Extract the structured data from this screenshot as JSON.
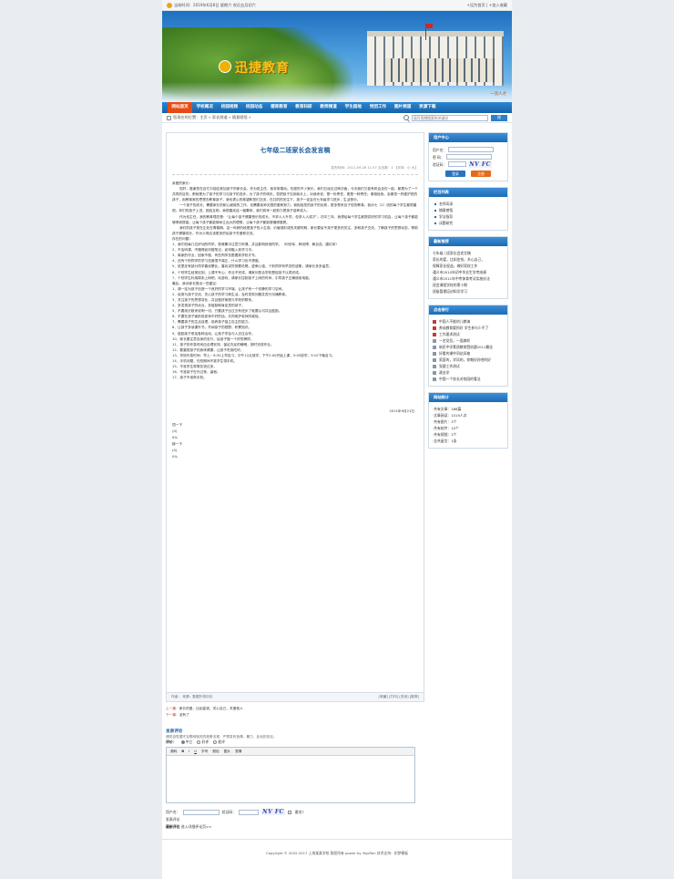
{
  "topbar": {
    "datetime": "当前时间：2019年6月8日 星期六 农历五月初六",
    "links": "+设为首页 | +加入收藏"
  },
  "banner": {
    "logo": "迅捷教育",
    "caption": "一流人才"
  },
  "nav": {
    "items": [
      "网站首页",
      "学校概况",
      "校园视频",
      "校园动态",
      "德育教育",
      "教育科研",
      "教师频道",
      "学生园地",
      "党团工作",
      "图片频道",
      "资源下载"
    ]
  },
  "subbar": {
    "breadcrumb": "您现在的位置：主页 » 家长频道 » 随意感悟 »",
    "search_placeholder": "填写您想搜索的关键词",
    "search_button": "搜"
  },
  "article": {
    "title": "七年级二班家长会发言稿",
    "meta": "发布时间：2011-09-26 11:37   点击数：1   【字体：小 大】",
    "paragraphs": [
      "亲爱的家长：",
      "您好，感谢您在百忙中抽空参加孩子的家长会，作为班主任，我非常感动。在座的不少家长，我们已经见过两次面，今天我们又能有机会坐在一起，都是为了一个共同的目的，那就是为了孩子的学习与孩子的进步。为了孩子的明天，您把孩子交到我手上，对我来说，是一份责任，更是一种责任；请相信我，会像您一样爱护您的孩子，用教育家的思想去教育孩子，我也衷心的希望和您们交流，在共同的关注下，孩子一定会在七年级学习进步，生活快乐。",
      "一个孩子的成长，需要家长的耐心细致的工作，也需要老师无限的爱和努力，我相信您的孩子的优秀，更多是来自于您的教育。我对七（2）班的每个学生都很重视，你们的孩子上进，团结互助，我很喜欢这一届集体，我们将来一起努力把孩子培养成人。",
      "作为班主任，我的教育理念是：“让每个孩子健康快乐的成长，不求人人升学，但求人人成才”。初中三年，我想给每个学生都提供好的学习机会，让每个孩子都能够得到提高，让每个孩子都能够树立远大的理想，让每个孩子都能够懂得感恩。",
      "我们的孩子现在正处在青春期，这一年龄阶段是孩子的人生观、价值观形成的关键时期，家长要给予孩子更多的关注，多和孩子交流，了解孩子的思想动态，帮助孩子健康成长，作为父母应该更多的给孩子关爱和交流。",
      "存在的问题：",
      "1、我们班每几位好动的同学，很难集中注意力听课，并且影响其他同学。（何世军、韩世博、黄百浩、唐红军）",
      "2、不会听课，不懂得如何做笔记，如何融入到学习中。",
      "3、离家的作业，回家不做，有些同学总是要到学校才写。",
      "4、还有个别同学的学习态度很不端正，什么学习也不想做。",
      "5、班里还有部分同学喜欢攀比，喜欢讲究穿着吃喝，虚荣心强，个别同学有早恋的迹象，请家长多多留意。",
      "6、个别学生经常迟到，上课不专心，作业不完成，请家长配合学校督促孩子认真完成。",
      "7、个别学生利用周末上网吧，玩游戏，请家长控制孩子上网的时间，引导孩子正确使用电脑。",
      "最后，我对家长提出一些建议：",
      "1、请一定为孩子创造一个良好的学习环境，让孩子有一个安静的学习空间。",
      "2、经常与孩子交流，关心孩子的学习和生活，及时发现问题并进行沟通教育。",
      "3、关注孩子的思想变化，并且做好家庭与学校的联系。",
      "4、多发现孩子的优点，多鼓励和肯定您的孩子。",
      "5、不要用分数来说明一切，只要孩子比过去有进步了就要认可并且鼓励。",
      "6、不要在孩子面前说老师不好的话，共同维护老师的威信。",
      "7、需要孩子的生活自理，培养孩子独立自主的能力。",
      "8、让孩子多读课外书，开阔孩子的视野，积累知识。",
      "9、鼓励孩子参加各种活动，让孩子学会与人交往合作。",
      "10、家长要注意自身的言行，给孩子做一个好的榜样。",
      "11、孩子的作息时间应合理安排，保证充足的睡眠，按时完成作业。",
      "12、要重视孩子的身体健康，让孩子吃饱吃好。",
      "13、学校作息时间：早上：6:30上早自习，中午12点放学，下午2:00开始上课，5:05放学，9:10下晚自习。",
      "14、手机问题，在校期间不准学生带手机。",
      "15、不准学生带零花钱过多。",
      "16、不准孩子在外过夜、留宿。",
      "17、孩子不准带手机。"
    ],
    "sign_date": "2011年9月21日",
    "vote_lines": [
      "顶一下",
      "(0)",
      "0%",
      "踩一下",
      "(0)",
      "0%"
    ],
    "footer_left": "作者：  来源：数据外将评论",
    "footer_right": "[收藏] [打印] [关闭] [推荐]"
  },
  "prevnext": {
    "prev_label": "上一篇：",
    "prev_text": "家长的爱，比如金钱，关心自己，关爱他人",
    "next_label": "下一篇：",
    "next_text": "没有了"
  },
  "comments": {
    "heading": "发表评论",
    "rule": "请您自觉遵守互联网相关的政策法规，严禁发布色情、暴力、反动的言论。",
    "rating_label": "评价：",
    "ratings": [
      "中立",
      "好评",
      "差评"
    ],
    "toolbar_items": [
      "源码",
      "B",
      "I",
      "U",
      "字号",
      "颜色",
      "图片",
      "表情"
    ],
    "username_label": "用户名：",
    "captcha_label": "验证码：",
    "captcha": "NV FC",
    "anon_label": "匿名?",
    "submit": "发表评论",
    "latest": "最新评论",
    "latest_link": "进入详细评论页>>"
  },
  "sidebar": {
    "login": {
      "title": "用户中心",
      "user_label": "用户名：",
      "pass_label": "密  码：",
      "captcha_label": "验证码：",
      "captcha": "NV FC",
      "login_btn": "登录",
      "reg_btn": "注册"
    },
    "columns": {
      "title": "栏目列表",
      "items": [
        "名师风采",
        "随意感悟",
        "学法指导",
        "试题研究"
      ]
    },
    "recommend": {
      "title": "最新推荐",
      "items": [
        "七年级二班家长会发言稿",
        "家长的爱，比如金钱，关心自己，",
        "保障家长权益，做好家校工作",
        "通义市2010年初中毕业生学考成绩",
        "通义市2011年中考体育考试实施办法",
        "班会课程学校的第十期",
        "班级管理培训知识学习"
      ]
    },
    "hot": {
      "title": "点击排行",
      "items": [
        "中国人不能的儿教诲",
        "养成教育要抓好 学生参与少不了",
        "工作要求测试",
        "一名党员，一面旗帜",
        "新民中学素质教育暨创建2011最佳",
        "好看的课件同站风格",
        "家庭的，学风的，你教好好吧的好",
        "党建工作测试",
        "政治学",
        "中国一个校长对校园的看法"
      ]
    },
    "stats": {
      "title": "网站统计",
      "items": [
        "·共有文章：288篇",
        "·文章阅读：1019人次",
        "·共有图片：3个",
        "·共有软件：10个",
        "·共有视频：3个",
        "·总共留言：1条"
      ]
    }
  },
  "footer": {
    "text": "Copyright © 2002-2017 上海某某学校 版权所有 power by YojuRen  技术支持：织梦模板"
  }
}
